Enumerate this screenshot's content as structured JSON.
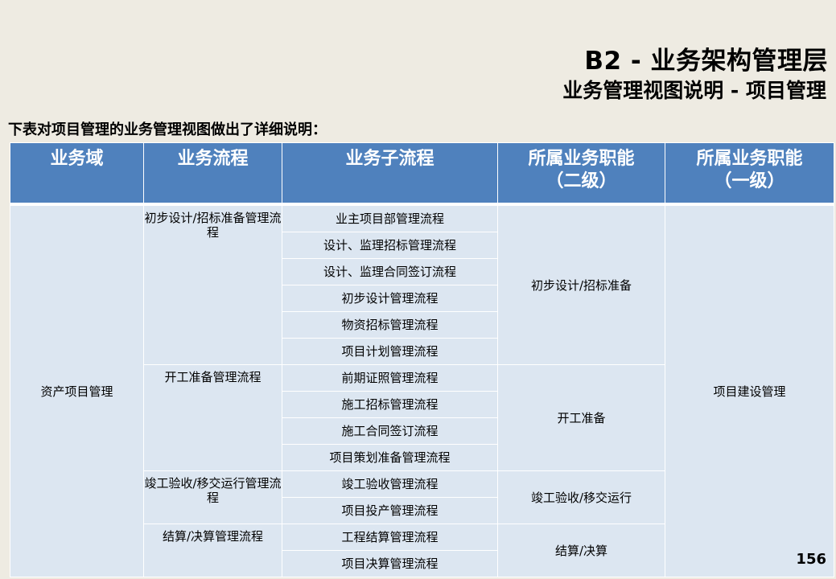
{
  "header": {
    "title": "B2 - 业务架构管理层",
    "subtitle": "业务管理视图说明 - 项目管理"
  },
  "intro": "下表对项目管理的业务管理视图做出了详细说明：",
  "table": {
    "headers": {
      "domain": "业务域",
      "process": "业务流程",
      "subprocess": "业务子流程",
      "func2_line1": "所属业务职能",
      "func2_line2": "（二级）",
      "func1_line1": "所属业务职能",
      "func1_line2": "（一级）"
    },
    "domain": "资产项目管理",
    "func1": "项目建设管理",
    "processes": [
      "初步设计/招标准备管理流程",
      "开工准备管理流程",
      "竣工验收/移交运行管理流程",
      "结算/决算管理流程"
    ],
    "subprocesses": [
      "业主项目部管理流程",
      "设计、监理招标管理流程",
      "设计、监理合同签订流程",
      "初步设计管理流程",
      "物资招标管理流程",
      "项目计划管理流程",
      "前期证照管理流程",
      "施工招标管理流程",
      "施工合同签订流程",
      "项目策划准备管理流程",
      "竣工验收管理流程",
      "项目投产管理流程",
      "工程结算管理流程",
      "项目决算管理流程"
    ],
    "func2": [
      "初步设计/招标准备",
      "开工准备",
      "竣工验收/移交运行",
      "结算/决算"
    ]
  },
  "page_number": "156"
}
